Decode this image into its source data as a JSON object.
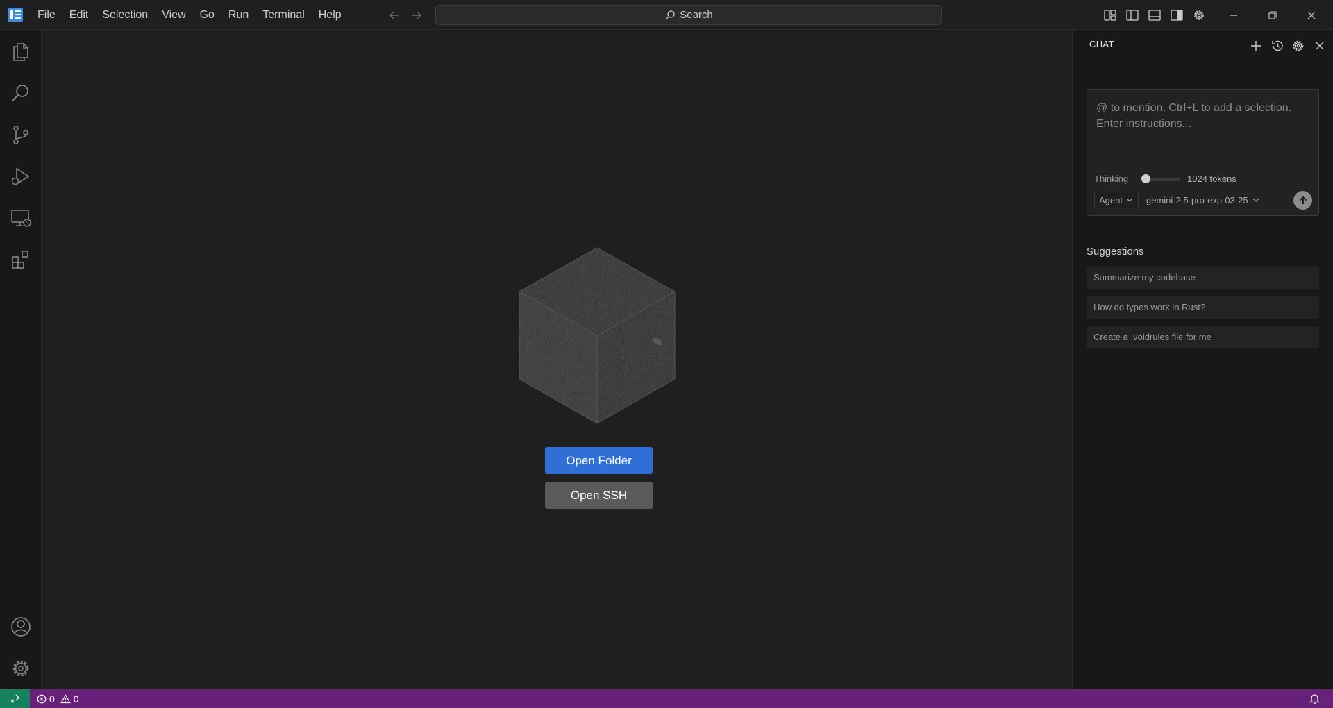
{
  "menu": {
    "items": [
      "File",
      "Edit",
      "Selection",
      "View",
      "Go",
      "Run",
      "Terminal",
      "Help"
    ]
  },
  "search": {
    "label": "Search"
  },
  "welcome": {
    "open_folder_label": "Open Folder",
    "open_ssh_label": "Open SSH"
  },
  "chat": {
    "tab_title": "CHAT",
    "input_placeholder": "@ to mention, Ctrl+L to add a selection. Enter instructions...",
    "thinking_label": "Thinking",
    "thinking_level": 0,
    "tokens_label": "1024 tokens",
    "mode": "Agent",
    "model": "gemini-2.5-pro-exp-03-25",
    "suggestions_title": "Suggestions",
    "suggestions": [
      "Summarize my codebase",
      "How do types work in Rust?",
      "Create a .voidrules file for me"
    ]
  },
  "status": {
    "errors": "0",
    "warnings": "0"
  },
  "colors": {
    "accent_button": "#2f6fd6",
    "status_bar": "#68217a",
    "remote_indicator": "#16825d"
  }
}
